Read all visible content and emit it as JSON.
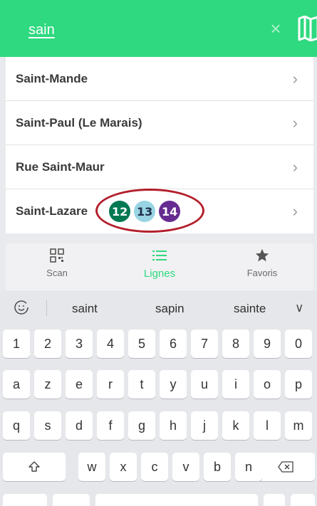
{
  "search": {
    "query": "sain"
  },
  "results": [
    {
      "name": "Saint-Mande",
      "lines": []
    },
    {
      "name": "Saint-Paul (Le Marais)",
      "lines": []
    },
    {
      "name": "Rue Saint-Maur",
      "lines": []
    },
    {
      "name": "Saint-Lazare",
      "lines": [
        {
          "number": "12",
          "color": "#007852"
        },
        {
          "number": "13",
          "color": "#98d4e2"
        },
        {
          "number": "14",
          "color": "#662c91"
        }
      ]
    }
  ],
  "bottom_nav": [
    {
      "label": "Scan",
      "icon": "qr-code-icon",
      "active": false
    },
    {
      "label": "Lignes",
      "icon": "list-icon",
      "active": true
    },
    {
      "label": "Favoris",
      "icon": "star-icon",
      "active": false
    }
  ],
  "keyboard": {
    "suggestions": [
      "saint",
      "sapin",
      "sainte"
    ],
    "number_row": [
      "1",
      "2",
      "3",
      "4",
      "5",
      "6",
      "7",
      "8",
      "9",
      "0"
    ],
    "row1": [
      "a",
      "z",
      "e",
      "r",
      "t",
      "y",
      "u",
      "i",
      "o",
      "p"
    ],
    "row2": [
      "q",
      "s",
      "d",
      "f",
      "g",
      "h",
      "j",
      "k",
      "l",
      "m"
    ],
    "row3": [
      "w",
      "x",
      "c",
      "v",
      "b",
      "n"
    ]
  },
  "colors": {
    "accent": "#2fd97f",
    "highlight_ring": "#b31f2b"
  }
}
